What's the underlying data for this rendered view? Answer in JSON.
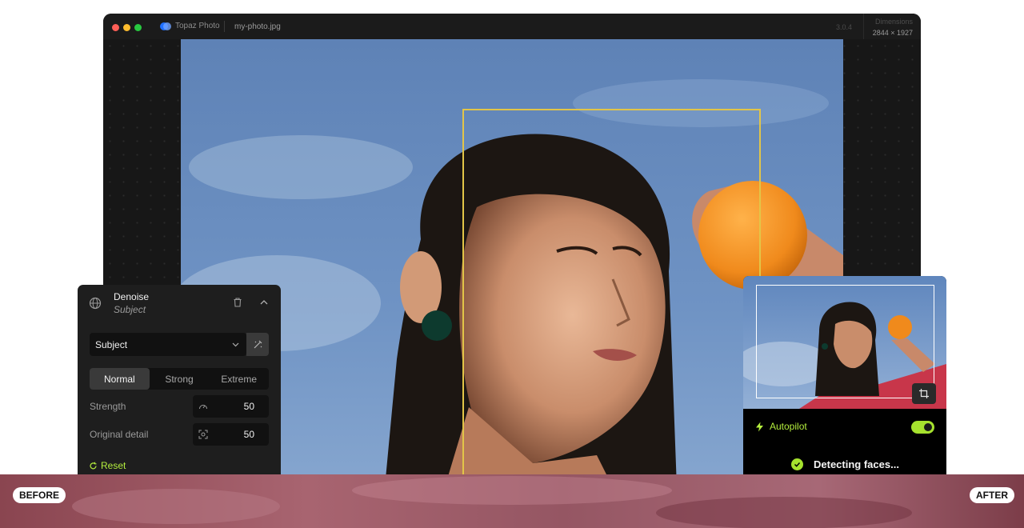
{
  "window": {
    "app_name": "Topaz Photo",
    "file_name": "my-photo.jpg",
    "version": "3.0.4",
    "dimensions_label": "Dimensions",
    "dimensions_value": "2844 × 1927"
  },
  "denoise_panel": {
    "title": "Denoise",
    "subtitle": "Subject",
    "model_select": {
      "value": "Subject"
    },
    "strength_modes": [
      {
        "label": "Normal",
        "active": true
      },
      {
        "label": "Strong",
        "active": false
      },
      {
        "label": "Extreme",
        "active": false
      }
    ],
    "params": [
      {
        "label": "Strength",
        "value": "50",
        "icon": "speed-icon"
      },
      {
        "label": "Original detail",
        "value": "50",
        "icon": "detail-icon"
      }
    ],
    "reset_label": "Reset"
  },
  "preview_panel": {
    "autopilot_label": "Autopilot",
    "autopilot_enabled": true,
    "status_text": "Detecting faces..."
  },
  "comparison": {
    "before_label": "BEFORE",
    "after_label": "AFTER"
  },
  "colors": {
    "accent": "#b5ef3e",
    "crop_outline": "#e2c548",
    "panel_bg": "#1e1e1e"
  }
}
